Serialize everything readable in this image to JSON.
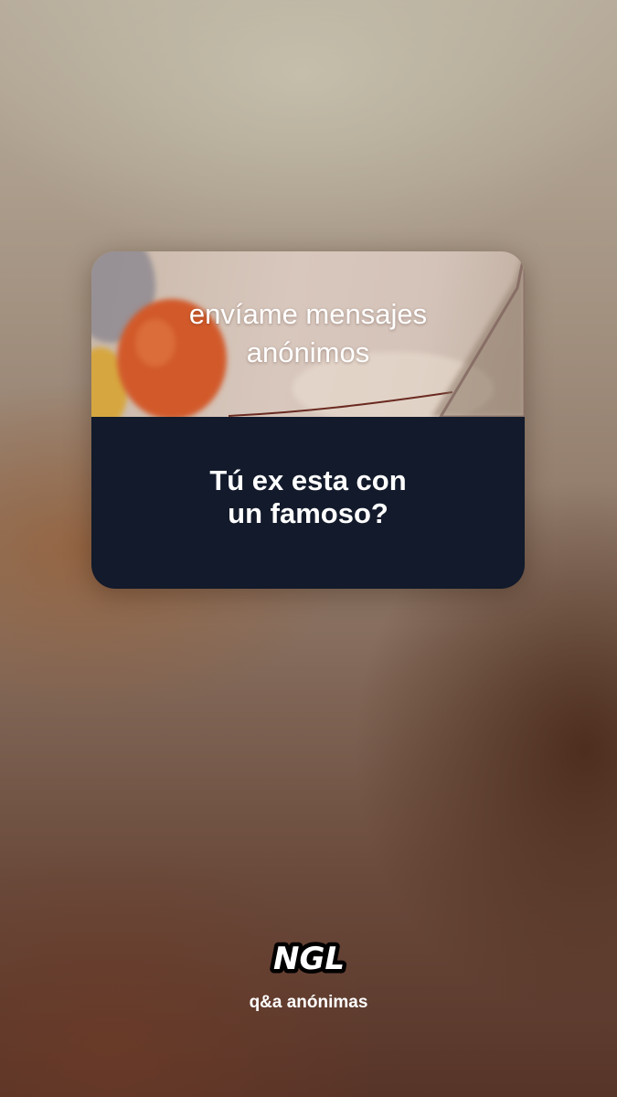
{
  "card": {
    "title_lines": [
      "envíame mensajes",
      "anónimos"
    ],
    "question_lines": [
      "Tú ex esta con",
      "un famoso?"
    ],
    "colors": {
      "question_bg": "#121a2b",
      "balloon": "#d25a2b"
    }
  },
  "footer": {
    "logo_text": "NGL",
    "tagline": "q&a anónimas"
  }
}
